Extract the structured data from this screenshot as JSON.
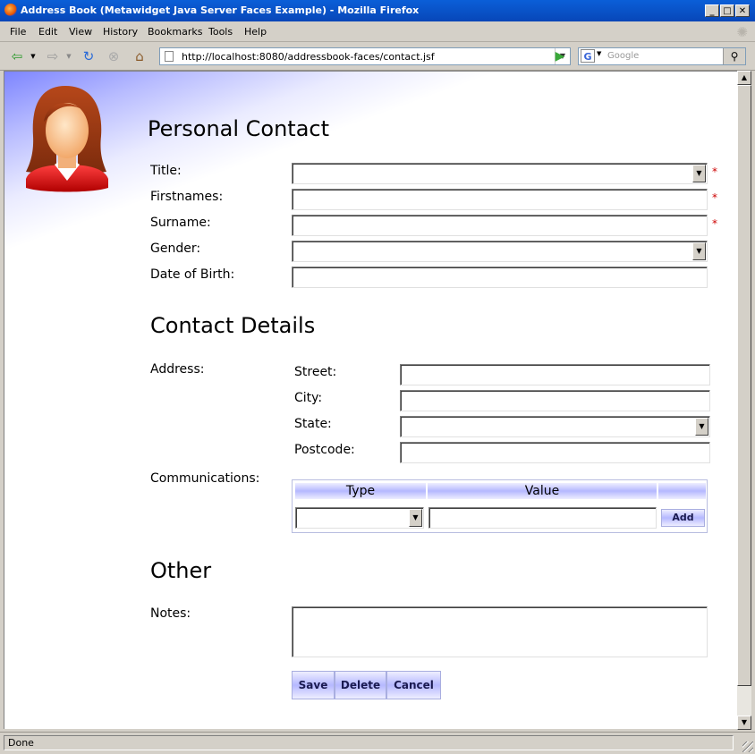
{
  "window": {
    "title": "Address Book (Metawidget Java Server Faces Example) - Mozilla Firefox"
  },
  "menu": [
    "File",
    "Edit",
    "View",
    "History",
    "Bookmarks",
    "Tools",
    "Help"
  ],
  "nav": {
    "url": "http://localhost:8080/addressbook-faces/contact.jsf",
    "search_placeholder": "Google"
  },
  "page": {
    "personal_heading": "Personal Contact",
    "labels": {
      "title": "Title:",
      "firstnames": "Firstnames:",
      "surname": "Surname:",
      "gender": "Gender:",
      "dob": "Date of Birth:"
    },
    "required_mark": "*",
    "contact_heading": "Contact Details",
    "address_label": "Address:",
    "address": {
      "street": "Street:",
      "city": "City:",
      "state": "State:",
      "postcode": "Postcode:"
    },
    "communications_label": "Communications:",
    "comm_table": {
      "type_header": "Type",
      "value_header": "Value",
      "add_label": "Add"
    },
    "other_heading": "Other",
    "notes_label": "Notes:",
    "buttons": {
      "save": "Save",
      "delete": "Delete",
      "cancel": "Cancel"
    }
  },
  "status": "Done"
}
